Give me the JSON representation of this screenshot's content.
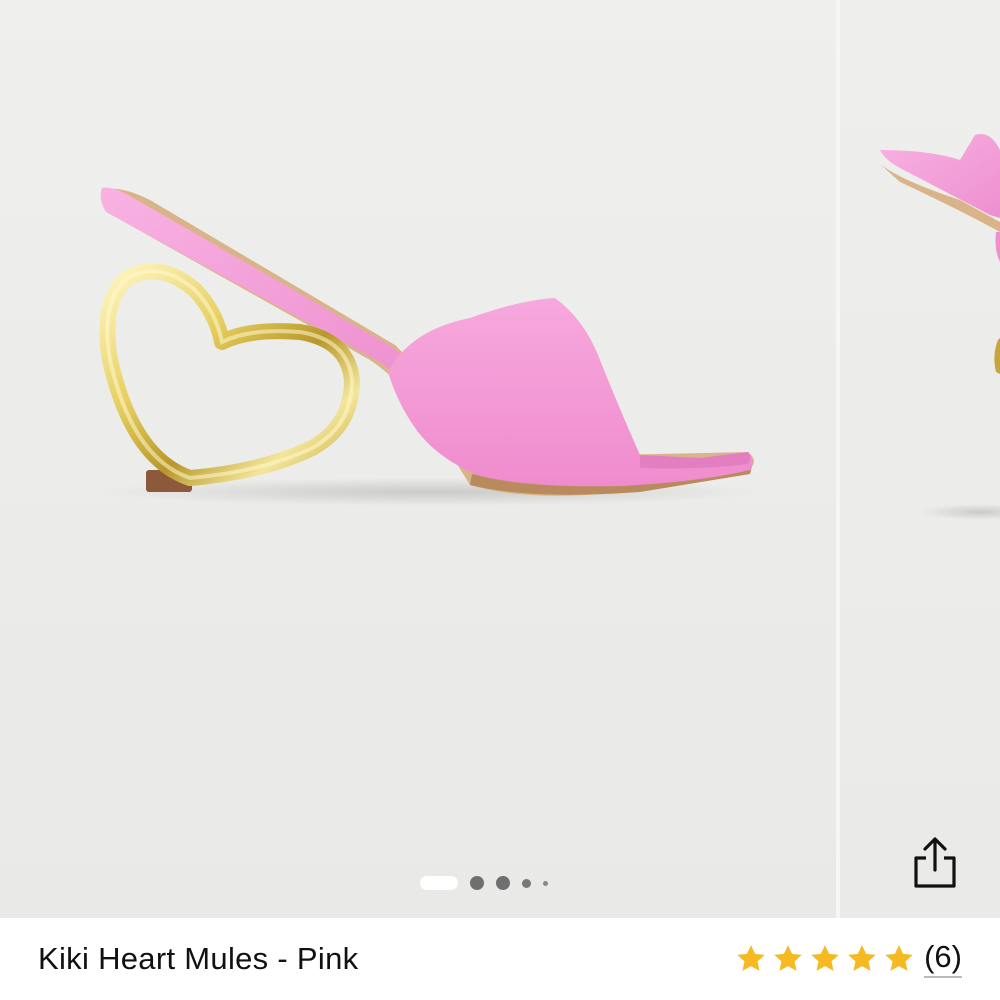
{
  "product": {
    "title": "Kiki Heart Mules - Pink",
    "color_name": "Pink",
    "accent_pink": "#f39bd6",
    "heel_gold": "#e8d36a"
  },
  "gallery": {
    "slides_count": 5,
    "active_index": 0
  },
  "rating": {
    "stars": 5,
    "star_color": "#f5b921",
    "review_count": "(6)"
  },
  "icons": {
    "share": "share-icon",
    "star": "star-icon"
  }
}
